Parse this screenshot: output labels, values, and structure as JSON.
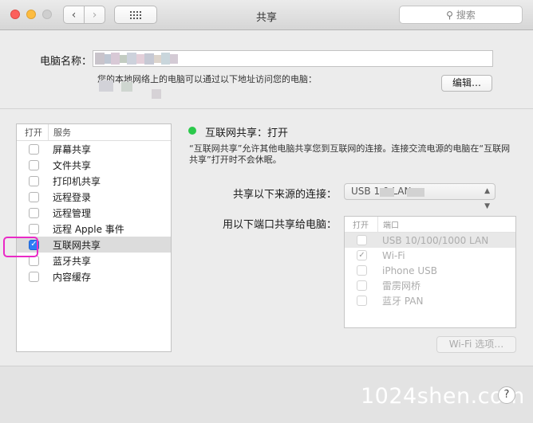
{
  "window": {
    "title": "共享",
    "search_placeholder": "搜索"
  },
  "top": {
    "computer_name_label": "电脑名称：",
    "name_hint": "您的本地网络上的电脑可以通过以下地址访问您的电脑：",
    "edit_label": "编辑…"
  },
  "services": {
    "header_open": "打开",
    "header_service": "服务",
    "items": [
      {
        "label": "屏幕共享",
        "checked": false
      },
      {
        "label": "文件共享",
        "checked": false
      },
      {
        "label": "打印机共享",
        "checked": false
      },
      {
        "label": "远程登录",
        "checked": false
      },
      {
        "label": "远程管理",
        "checked": false
      },
      {
        "label": "远程 Apple 事件",
        "checked": false
      },
      {
        "label": "互联网共享",
        "checked": true,
        "selected": true
      },
      {
        "label": "蓝牙共享",
        "checked": false
      },
      {
        "label": "内容缓存",
        "checked": false
      }
    ]
  },
  "detail": {
    "status_title": "互联网共享：打开",
    "status_color": "#2bc94b",
    "description": "“互联网共享”允许其他电脑共享您到互联网的连接。连接交流电源的电脑在“互联网共享”打开时不会休眠。",
    "source_label": "共享以下来源的连接：",
    "source_value": "USB 1     0 LAN",
    "ports_label": "用以下端口共享给电脑：",
    "ports_header_open": "打开",
    "ports_header_port": "端口",
    "ports": [
      {
        "label": "USB 10/100/1000 LAN",
        "checked": false
      },
      {
        "label": "Wi-Fi",
        "checked": true
      },
      {
        "label": "iPhone USB",
        "checked": false
      },
      {
        "label": "雷雳网桥",
        "checked": false
      },
      {
        "label": "蓝牙 PAN",
        "checked": false
      }
    ],
    "wifi_options_label": "Wi-Fi 选项…"
  },
  "footer": {
    "help_label": "?",
    "watermark": "1024shen.com"
  },
  "colors": {
    "accent": "#2d7cf6",
    "highlight_box": "#e92ac6"
  }
}
